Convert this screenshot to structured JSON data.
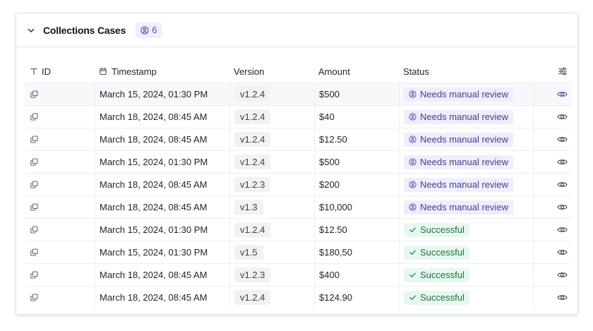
{
  "header": {
    "title": "Collections Cases",
    "count": "6"
  },
  "columns": {
    "id": "ID",
    "timestamp": "Timestamp",
    "version": "Version",
    "amount": "Amount",
    "status": "Status"
  },
  "rows": [
    {
      "timestamp": "March 15, 2024, 01:30 PM",
      "version": "v1.2.4",
      "amount": "$500",
      "status": "Needs manual review",
      "status_type": "review"
    },
    {
      "timestamp": "March 18, 2024, 08:45 AM",
      "version": "v1.2.4",
      "amount": "$40",
      "status": "Needs manual review",
      "status_type": "review"
    },
    {
      "timestamp": "March 18, 2024, 08:45 AM",
      "version": "v1.2.4",
      "amount": "$12.50",
      "status": "Needs manual review",
      "status_type": "review"
    },
    {
      "timestamp": "March 15, 2024, 01:30 PM",
      "version": "v1.2.4",
      "amount": "$500",
      "status": "Needs manual review",
      "status_type": "review"
    },
    {
      "timestamp": "March 18, 2024, 08:45 AM",
      "version": "v1.2.3",
      "amount": "$200",
      "status": "Needs manual review",
      "status_type": "review"
    },
    {
      "timestamp": "March 18, 2024, 08:45 AM",
      "version": "v1.3",
      "amount": "$10,000",
      "status": "Needs manual review",
      "status_type": "review"
    },
    {
      "timestamp": "March 15, 2024, 01:30 PM",
      "version": "v1.2.4",
      "amount": "$12.50",
      "status": "Successful",
      "status_type": "success"
    },
    {
      "timestamp": "March 15, 2024, 01:30 PM",
      "version": "v1.5",
      "amount": "$180,50",
      "status": "Successful",
      "status_type": "success"
    },
    {
      "timestamp": "March 18, 2024, 08:45 AM",
      "version": "v1.2.3",
      "amount": "$400",
      "status": "Successful",
      "status_type": "success"
    },
    {
      "timestamp": "March 18, 2024, 08:45 AM",
      "version": "v1.2.4",
      "amount": "$124.90",
      "status": "Successful",
      "status_type": "success"
    }
  ],
  "colors": {
    "accent": "#4b4fc8",
    "review_bg": "#eeeefd",
    "success_bg": "#e8f8ef",
    "success_fg": "#17753f"
  },
  "icons": {
    "collapse": "chevron-down-icon",
    "count": "user-circle-icon",
    "id_column": "text-type-icon",
    "timestamp_column": "calendar-icon",
    "settings": "sliders-icon",
    "copy": "copy-icon",
    "view": "eye-icon",
    "review": "user-circle-icon",
    "success": "check-icon"
  }
}
